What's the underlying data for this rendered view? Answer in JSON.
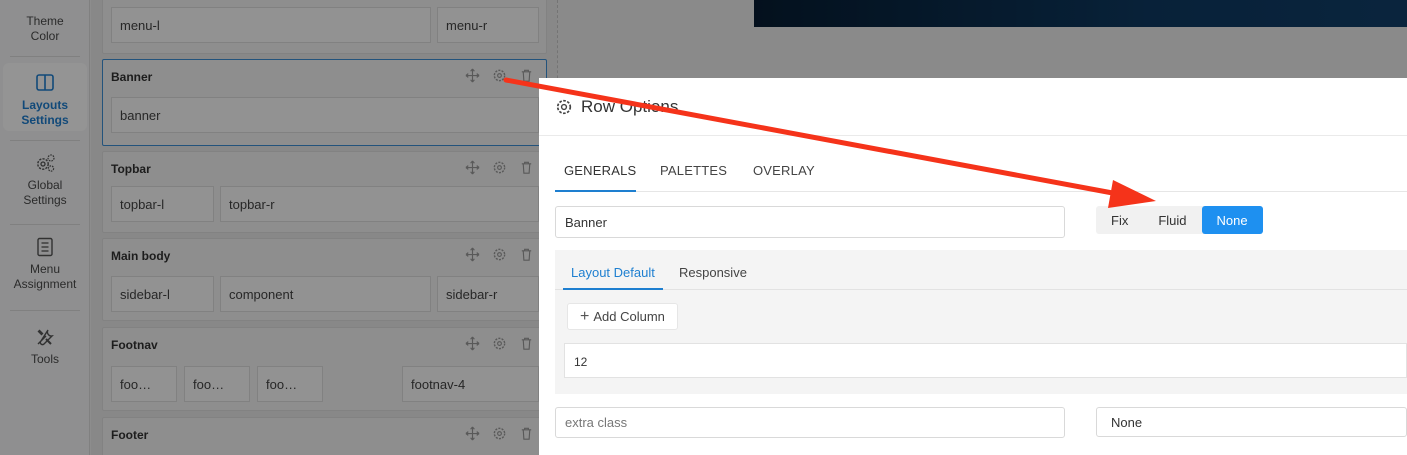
{
  "sidebar": {
    "items": [
      {
        "label": "Theme Color",
        "icon": "theme-color-icon"
      },
      {
        "label": "Layouts Settings",
        "icon": "layout-columns-icon",
        "active": true
      },
      {
        "label": "Global Settings",
        "icon": "gears-icon"
      },
      {
        "label": "Menu Assignment",
        "icon": "menu-list-icon"
      },
      {
        "label": "Tools",
        "icon": "tools-icon"
      }
    ]
  },
  "builder": {
    "rows": [
      {
        "title": "",
        "columns": [
          "menu-l",
          "menu-r"
        ]
      },
      {
        "title": "Banner",
        "columns": [
          "banner"
        ],
        "selected": true
      },
      {
        "title": "Topbar",
        "columns": [
          "topbar-l",
          "topbar-r"
        ]
      },
      {
        "title": "Main body",
        "columns": [
          "sidebar-l",
          "component",
          "sidebar-r"
        ]
      },
      {
        "title": "Footnav",
        "columns": [
          "foo…",
          "foo…",
          "foo…",
          "footnav-4"
        ]
      },
      {
        "title": "Footer",
        "columns": []
      }
    ],
    "tool_icons": [
      "move-icon",
      "gear-icon",
      "trash-icon"
    ]
  },
  "modal": {
    "title": "Row Options",
    "tabs": [
      {
        "label": "GENERALS",
        "active": true
      },
      {
        "label": "PALETTES"
      },
      {
        "label": "OVERLAY"
      }
    ],
    "row_name_value": "Banner",
    "width_options": [
      {
        "label": "Fix"
      },
      {
        "label": "Fluid"
      },
      {
        "label": "None",
        "active": true
      }
    ],
    "sub_tabs": [
      {
        "label": "Layout Default",
        "active": true
      },
      {
        "label": "Responsive"
      }
    ],
    "add_column_label": "Add Column",
    "column_value": "12",
    "extra_class_placeholder": "extra class",
    "select_value": "None"
  },
  "colors": {
    "accent": "#1e90f0",
    "annotation_arrow": "#f5331a"
  }
}
